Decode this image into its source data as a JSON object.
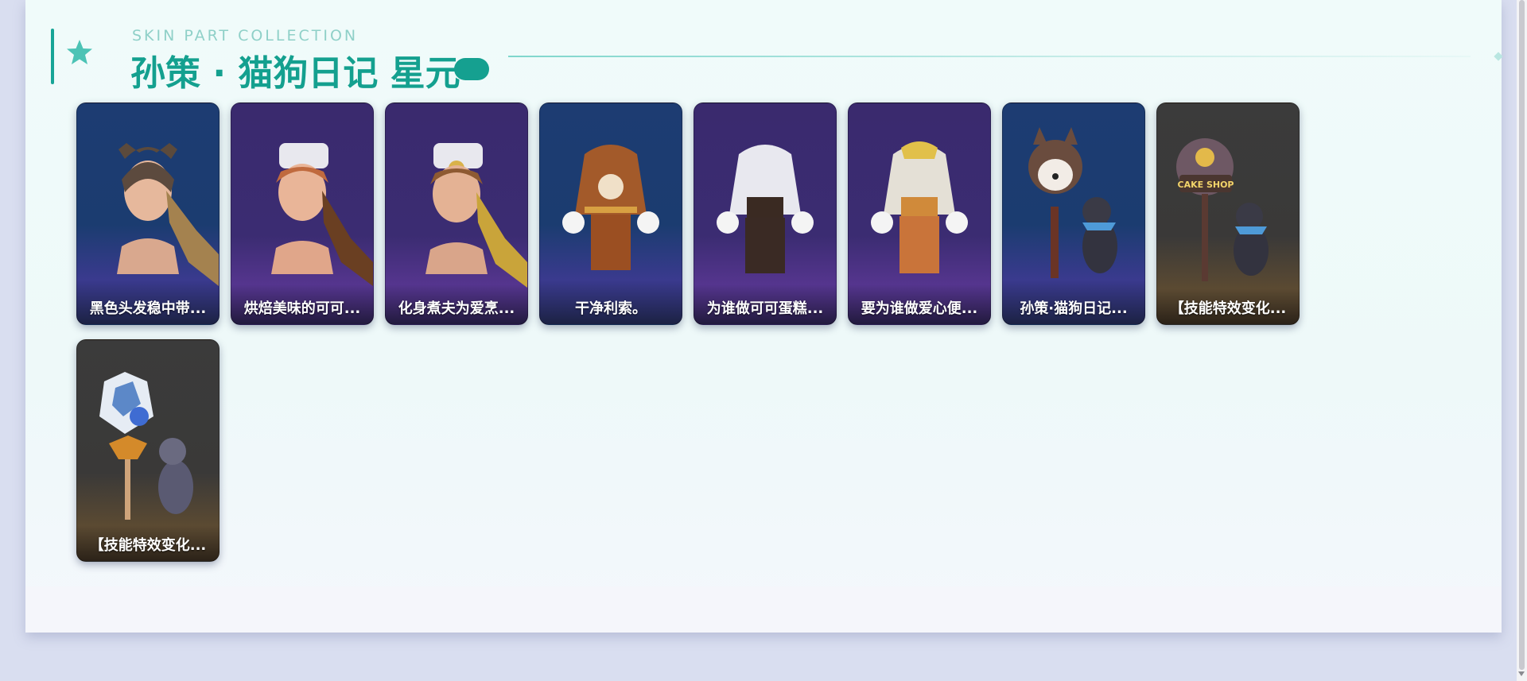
{
  "header": {
    "subtitle": "SKIN PART COLLECTION",
    "title": "孙策 · 猫狗日记 星元",
    "accent_color": "#14a08f"
  },
  "items": [
    {
      "label": "黑色头发稳中带...",
      "theme": "blue",
      "art": "head-ears"
    },
    {
      "label": "烘焙美味的可可...",
      "theme": "purple",
      "art": "head-chef"
    },
    {
      "label": "化身煮夫为爱烹...",
      "theme": "purple",
      "art": "head-chef-gold"
    },
    {
      "label": "干净利索。",
      "theme": "blue",
      "art": "outfit-brown"
    },
    {
      "label": "为谁做可可蛋糕...",
      "theme": "purple",
      "art": "outfit-chef"
    },
    {
      "label": "要为谁做爱心便...",
      "theme": "purple",
      "art": "outfit-orange"
    },
    {
      "label": "孙策·猫狗日记...",
      "theme": "blue",
      "art": "dog-staff"
    },
    {
      "label": "【技能特效变化...",
      "theme": "dark",
      "art": "cake-shop-sign"
    },
    {
      "label": "【技能特效变化...",
      "theme": "dark",
      "art": "wolf-staff"
    }
  ]
}
